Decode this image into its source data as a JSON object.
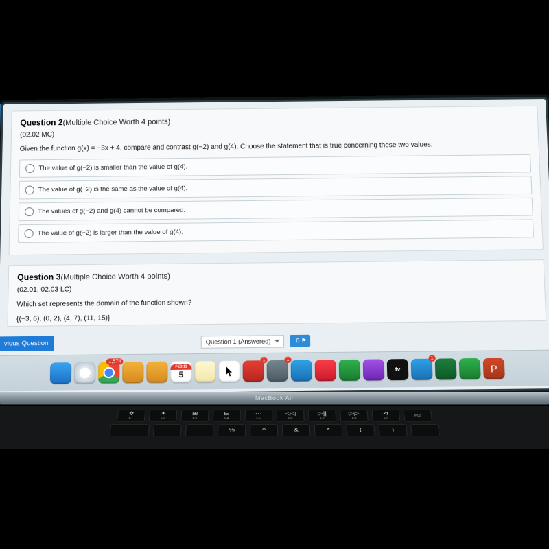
{
  "question2": {
    "title_bold": "Question 2",
    "title_rest": "(Multiple Choice Worth 4 points)",
    "code": "(02.02 MC)",
    "prompt": "Given the function g(x) = −3x + 4, compare and contrast g(−2) and g(4). Choose the statement that is true concerning these two values.",
    "options": [
      "The value of g(−2) is smaller than the value of g(4).",
      "The value of g(−2) is the same as the value of g(4).",
      "The values of g(−2) and g(4) cannot be compared.",
      "The value of g(−2) is larger than the value of g(4)."
    ]
  },
  "question3": {
    "title_bold": "Question 3",
    "title_rest": "(Multiple Choice Worth 4 points)",
    "code": "(02.01, 02.03 LC)",
    "prompt": "Which set represents the domain of the function shown?",
    "set": "{(−3, 6), (0, 2), (4, 7), (11, 15)}"
  },
  "nav": {
    "prev": "vious Question",
    "select": "Question 1 (Answered)",
    "flag": "0 ⚑"
  },
  "hinge": "MacBook Air",
  "dock": {
    "cal_month": "FEB  11",
    "cal_day": "5",
    "tv": "tv",
    "chrome_badge": "1,574",
    "safari_badge": "1",
    "gear_badge": "1",
    "store_badge": "1"
  },
  "keys": {
    "r1": [
      {
        "g": "✲",
        "l": "F1"
      },
      {
        "g": "☀",
        "l": "F2"
      },
      {
        "g": "⊞",
        "l": "F3"
      },
      {
        "g": "⊟",
        "l": "F4"
      },
      {
        "g": "⋯",
        "l": "F5"
      },
      {
        "g": "◁◁",
        "l": "F6"
      },
      {
        "g": "▷||",
        "l": "F7"
      },
      {
        "g": "▷▷",
        "l": "F8"
      },
      {
        "g": "⊲",
        "l": "F9"
      },
      {
        "g": "",
        "l": "F10"
      }
    ],
    "r2": [
      {
        "g": "",
        "l": ""
      },
      {
        "g": "",
        "l": ""
      },
      {
        "g": "",
        "l": ""
      },
      {
        "g": "%",
        "l": ""
      },
      {
        "g": "^",
        "l": ""
      },
      {
        "g": "&",
        "l": ""
      },
      {
        "g": "*",
        "l": ""
      },
      {
        "g": "(",
        "l": ""
      },
      {
        "g": ")",
        "l": ""
      },
      {
        "g": "—",
        "l": ""
      }
    ]
  }
}
